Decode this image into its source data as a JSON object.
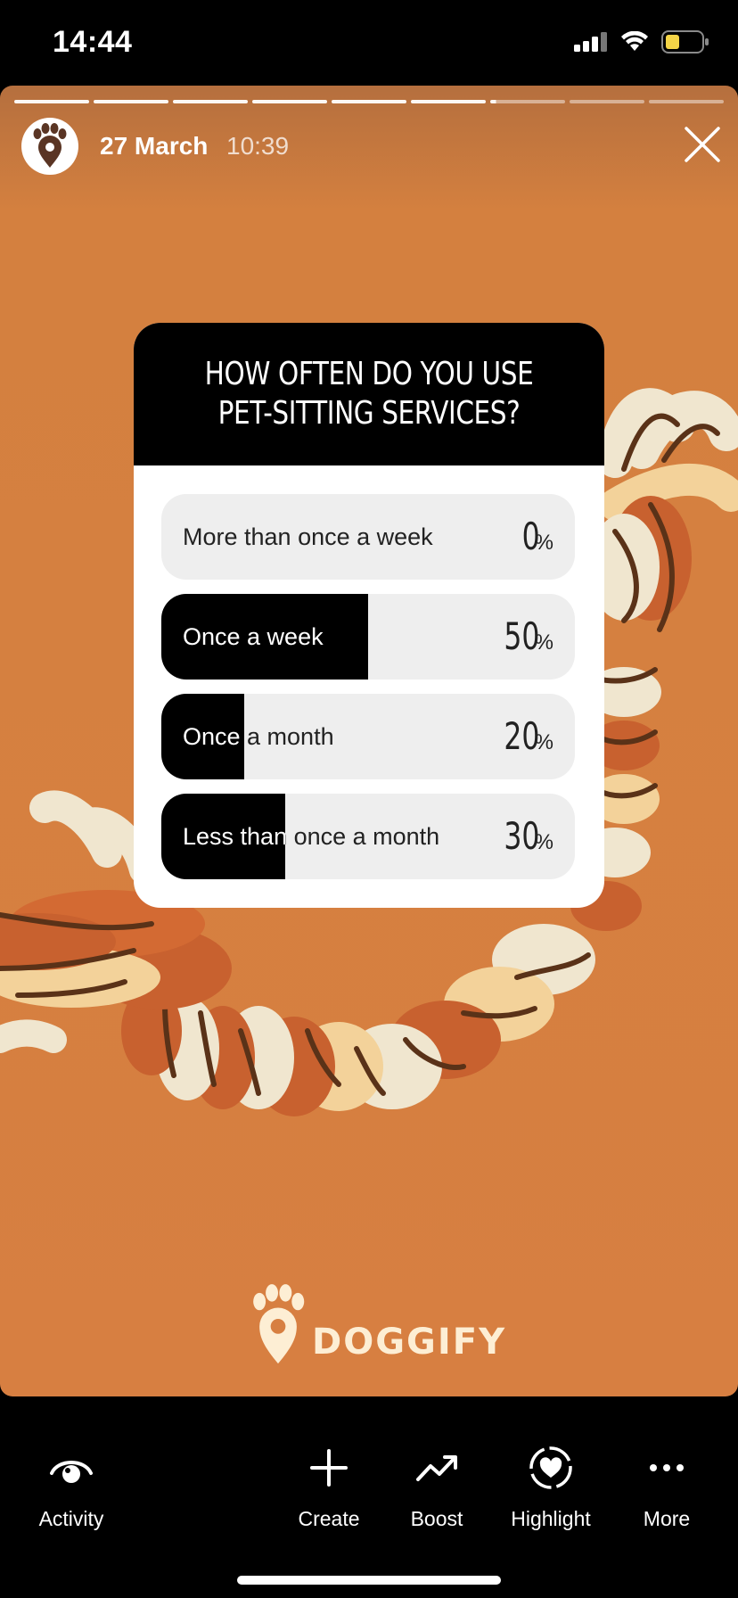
{
  "status_bar": {
    "time": "14:44"
  },
  "story": {
    "date": "27 March",
    "time": "10:39",
    "progress": {
      "segments": 9,
      "current_index": 6,
      "current_fraction": 0.08
    }
  },
  "poll": {
    "question": "HOW OFTEN DO YOU USE PET-SITTING SERVICES?",
    "options": [
      {
        "label": "More than once a week",
        "percent": "0",
        "fraction": 0.0
      },
      {
        "label": "Once a week",
        "percent": "50",
        "fraction": 0.5
      },
      {
        "label": "Once a month",
        "percent": "20",
        "fraction": 0.2
      },
      {
        "label": "Less than once a month",
        "percent": "30",
        "fraction": 0.3
      }
    ],
    "percent_sign": "%"
  },
  "brand": {
    "logo_text": "DOGGIFY"
  },
  "actions": [
    {
      "label": "Activity",
      "icon": "eye-icon"
    },
    {
      "label": "Create",
      "icon": "plus-icon"
    },
    {
      "label": "Boost",
      "icon": "trend-up-icon"
    },
    {
      "label": "Highlight",
      "icon": "highlight-heart-icon"
    },
    {
      "label": "More",
      "icon": "more-dots-icon"
    }
  ],
  "colors": {
    "story_bg": "#d77f41",
    "heart": "#e8333c",
    "poll_fill": "#000000",
    "poll_track": "#eeeeee"
  }
}
